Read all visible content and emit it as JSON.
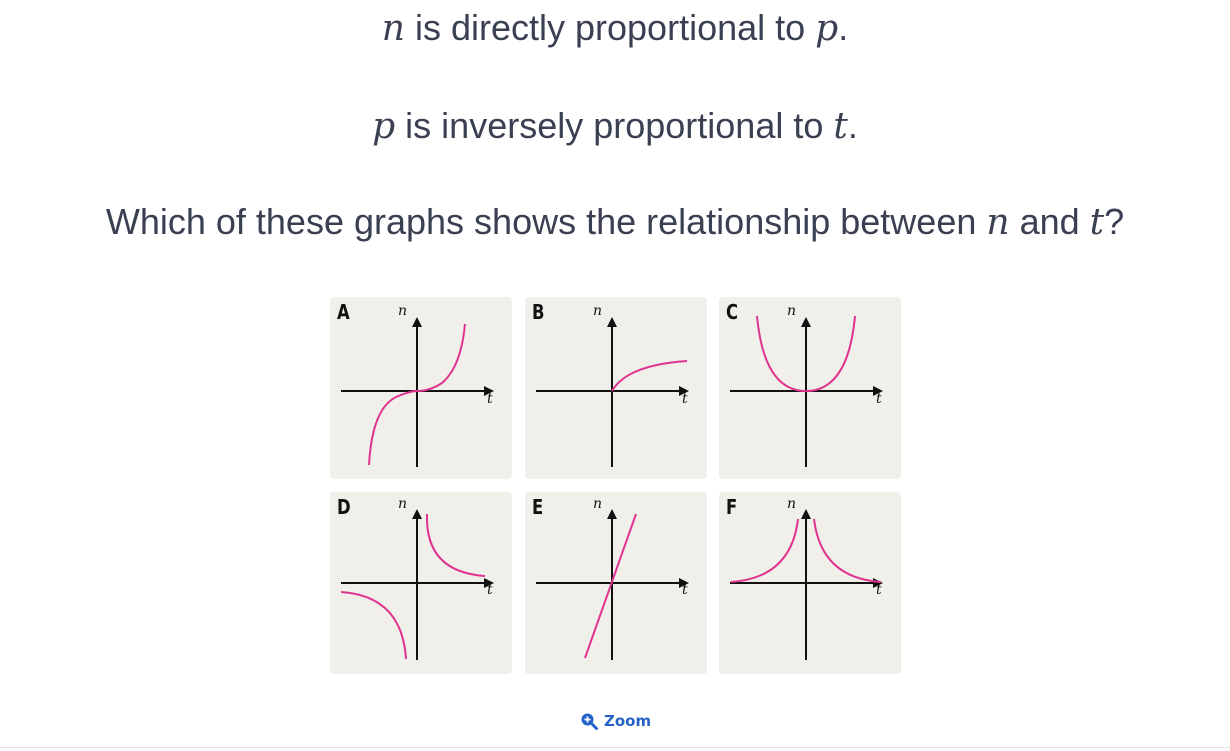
{
  "statements": {
    "line1": {
      "var_a": "n",
      "text": " is directly proportional to ",
      "var_b": "p",
      "end": "."
    },
    "line2": {
      "var_a": "p",
      "text": " is inversely proportional to ",
      "var_b": "t",
      "end": "."
    },
    "question": {
      "text": "Which of these graphs shows the relationship between ",
      "var_a": "n",
      "and": " and ",
      "var_b": "t",
      "end": "?"
    }
  },
  "graphs": {
    "y_axis_label": "n",
    "x_axis_label": "t",
    "curve_color": "#e0338f",
    "axis_color": "#111111",
    "panel_background": "#f1efea",
    "panels": [
      {
        "letter": "A",
        "shape": "cubic"
      },
      {
        "letter": "B",
        "shape": "increasing-decelerating-from-origin"
      },
      {
        "letter": "C",
        "shape": "even-power-u"
      },
      {
        "letter": "D",
        "shape": "reciprocal-1-over-t"
      },
      {
        "letter": "E",
        "shape": "straight-line-through-origin"
      },
      {
        "letter": "F",
        "shape": "reciprocal-squared-1-over-t2"
      }
    ]
  },
  "zoom": {
    "label": "Zoom",
    "icon": "zoom-in-icon",
    "color": "#2563c9"
  }
}
